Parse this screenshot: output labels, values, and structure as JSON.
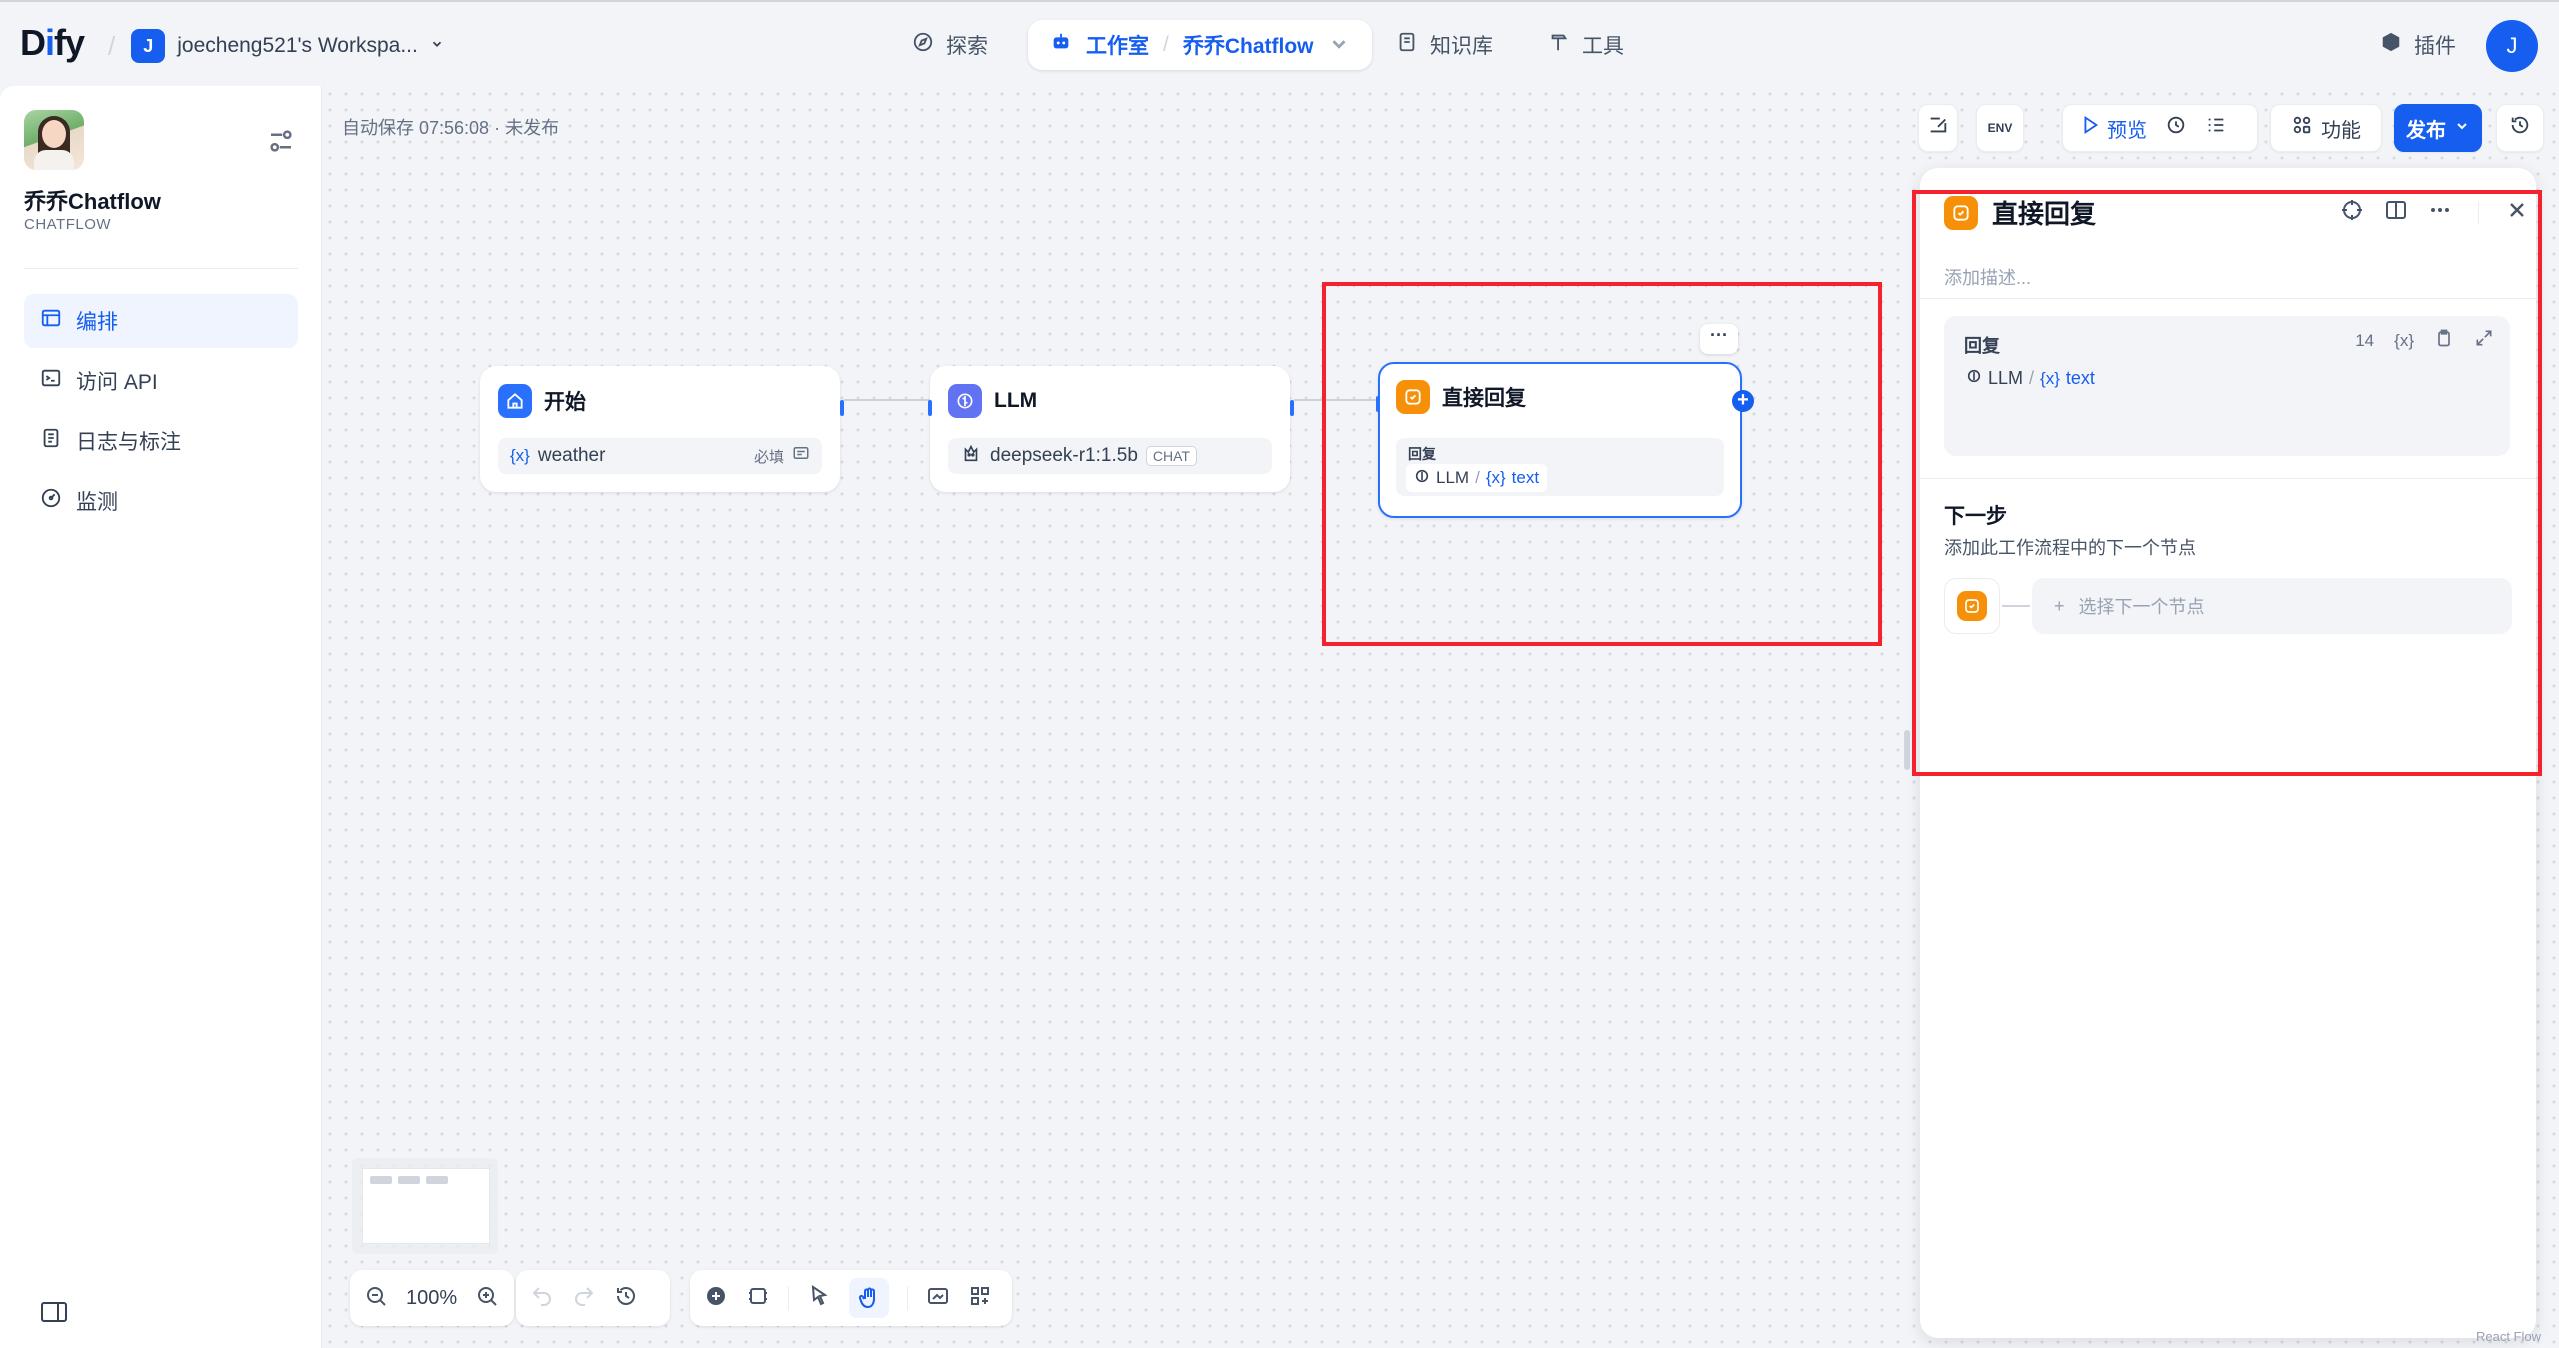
{
  "brand": {
    "logo_text_a": "D",
    "logo_text_b": "i",
    "logo_text_c": "fy"
  },
  "workspace": {
    "avatar_letter": "J",
    "name": "joecheng521's Workspa...",
    "chevron": "⌄"
  },
  "nav": {
    "explore": "探索",
    "studio": "工作室",
    "current_app": "乔乔Chatflow",
    "knowledge": "知识库",
    "tools": "工具",
    "plugins": "插件"
  },
  "user": {
    "avatar_letter": "J"
  },
  "sidebar": {
    "app_name": "乔乔Chatflow",
    "app_type": "CHATFLOW",
    "items": [
      {
        "label": "编排",
        "icon": "layout-icon",
        "active": true
      },
      {
        "label": "访问 API",
        "icon": "terminal-icon",
        "active": false
      },
      {
        "label": "日志与标注",
        "icon": "file-list-icon",
        "active": false
      },
      {
        "label": "监测",
        "icon": "dashboard-icon",
        "active": false
      }
    ]
  },
  "canvas": {
    "autosave": "自动保存 07:56:08 · 未发布",
    "toolbar": {
      "preview": "预览",
      "features": "功能",
      "publish": "发布",
      "env": "ENV"
    },
    "nodes": {
      "start": {
        "title": "开始",
        "var_symbol": "{x}",
        "var_name": "weather",
        "required": "必填"
      },
      "llm": {
        "title": "LLM",
        "model": "deepseek-r1:1.5b",
        "mode": "CHAT"
      },
      "answer": {
        "title": "直接回复",
        "reply_label": "回复",
        "source": "LLM",
        "var_symbol": "{x}",
        "var_name": "text",
        "more": "···"
      }
    },
    "zoom": "100%",
    "attribution": "React Flow"
  },
  "panel": {
    "title": "直接回复",
    "description_placeholder": "添加描述...",
    "reply_label": "回复",
    "reply_count": "14",
    "reply_var_symbol": "{x}",
    "reply_source": "LLM",
    "reply_var": "text",
    "next_title": "下一步",
    "next_desc": "添加此工作流程中的下一个节点",
    "next_select": "选择下一个节点",
    "next_plus": "+"
  },
  "colors": {
    "accent": "#155eef",
    "answer_node": "#f79009",
    "start_node": "#2970ff",
    "llm_node": "#6172f3",
    "highlight": "#f5222d"
  }
}
